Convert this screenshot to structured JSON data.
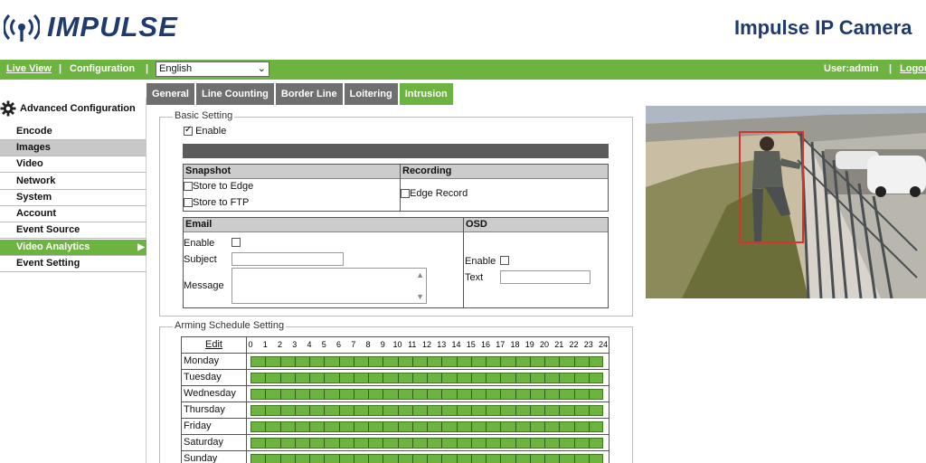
{
  "brand": {
    "logo_text": "IMPULSE",
    "product_title": "Impulse IP Camera"
  },
  "nav": {
    "live_view": "Live View",
    "sep1": "|",
    "configuration": "Configuration",
    "sep2": "|",
    "language_value": "English",
    "user": "User:admin",
    "sep3": "|",
    "logout": "Logout"
  },
  "sidebar": {
    "header": "Advanced Configuration",
    "items": [
      {
        "label": "Encode"
      },
      {
        "label": "Images"
      },
      {
        "label": "Video"
      },
      {
        "label": "Network"
      },
      {
        "label": "System"
      },
      {
        "label": "Account"
      },
      {
        "label": "Event Source"
      },
      {
        "label": "Video Analytics"
      },
      {
        "label": "Event Setting"
      }
    ]
  },
  "tabs": [
    "General",
    "Line Counting",
    "Border Line",
    "Loitering",
    "Intrusion"
  ],
  "basic": {
    "legend": "Basic Setting",
    "enable_label": "Enable",
    "enable_checked": true,
    "snapshot": {
      "title": "Snapshot",
      "store_edge": "Store to Edge",
      "store_ftp": "Store to FTP"
    },
    "recording": {
      "title": "Recording",
      "edge_record": "Edge Record"
    },
    "email": {
      "title": "Email",
      "enable": "Enable",
      "subject": "Subject",
      "message": "Message"
    },
    "osd": {
      "title": "OSD",
      "enable": "Enable",
      "text": "Text"
    }
  },
  "schedule": {
    "legend": "Arming Schedule Setting",
    "edit": "Edit",
    "hours": [
      "0",
      "1",
      "2",
      "3",
      "4",
      "5",
      "6",
      "7",
      "8",
      "9",
      "10",
      "11",
      "12",
      "13",
      "14",
      "15",
      "16",
      "17",
      "18",
      "19",
      "20",
      "21",
      "22",
      "23",
      "24"
    ],
    "days": [
      "Monday",
      "Tuesday",
      "Wednesday",
      "Thursday",
      "Friday",
      "Saturday",
      "Sunday"
    ]
  },
  "colors": {
    "accent": "#6db33f",
    "brand": "#1f3b6e",
    "tab_inactive": "#6f6f6f"
  }
}
